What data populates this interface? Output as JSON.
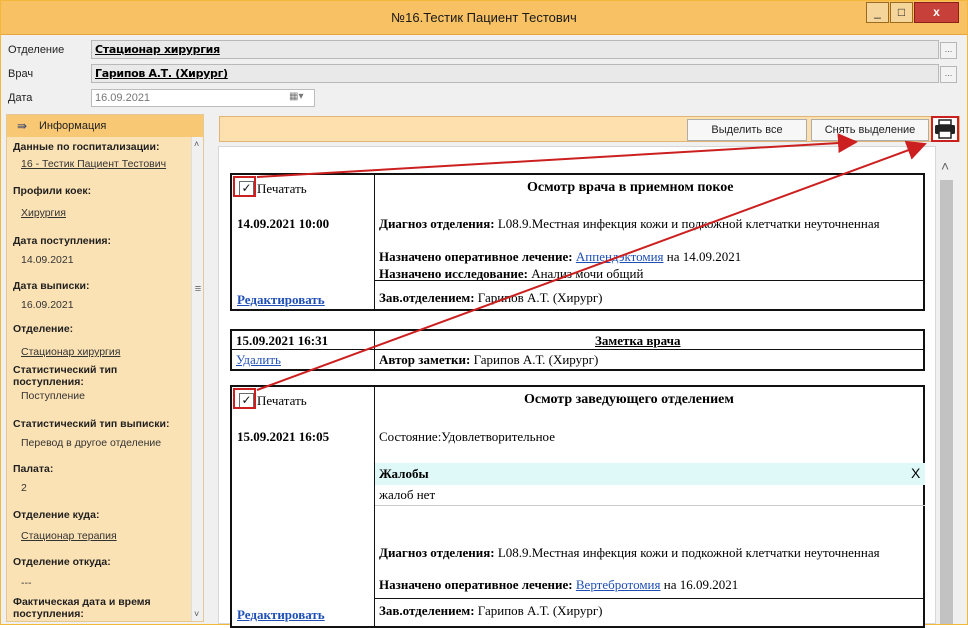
{
  "window": {
    "title": "№16.Тестик Пациент Тестович",
    "controls": {
      "minimize": "_",
      "maximize": "□",
      "close": "x"
    }
  },
  "form": {
    "department_label": "Отделение",
    "department_value": "Стационар хирургия",
    "doctor_label": "Врач",
    "doctor_value": "Гарипов А.Т. (Хирург)",
    "date_label": "Дата",
    "date_value": "16.09.2021",
    "ellipsis": "..."
  },
  "sidebar": {
    "header": "Информация",
    "items": [
      {
        "label": "Данные по госпитализации:",
        "value": "16 - Тестик Пациент Тестович",
        "link": true
      },
      {
        "label": "Профили коек:",
        "value": "Хирургия",
        "link": true
      },
      {
        "label": "Дата поступления:",
        "value": "14.09.2021",
        "link": false
      },
      {
        "label": "Дата выписки:",
        "value": "16.09.2021",
        "link": false
      },
      {
        "label": "Отделение:",
        "value": "Стационар хирургия",
        "link": true
      },
      {
        "label": "Статистический тип поступления:",
        "value": "Поступление",
        "link": false
      },
      {
        "label": "Статистический тип выписки:",
        "value": "Перевод в другое отделение",
        "link": false
      },
      {
        "label": "Палата:",
        "value": "2",
        "link": false
      },
      {
        "label": "Отделение куда:",
        "value": "Стационар терапия",
        "link": true
      },
      {
        "label": "Отделение откуда:",
        "value": "---",
        "link": false
      },
      {
        "label": "Фактическая дата и время поступления:",
        "value": "",
        "link": false
      }
    ]
  },
  "toolbar": {
    "select_all": "Выделить все",
    "deselect": "Снять выделение",
    "print_icon": "printer-icon"
  },
  "records": [
    {
      "print_label": "Печатать",
      "print_checked": true,
      "title": "Осмотр врача в приемном покое",
      "datetime": "14.09.2021 10:00",
      "diag_label": "Диагноз отделения:",
      "diag_value": "L08.9.Местная инфекция кожи и подкожной клетчатки неуточненная",
      "oper_label": "Назначено оперативное лечение:",
      "oper_link": "Аппендэктомия",
      "oper_suffix": "на 14.09.2021",
      "research_label": "Назначено исследование:",
      "research_value": "Анализ мочи общий",
      "edit_link": "Редактировать",
      "head_label": "Зав.отделением:",
      "head_value": "Гарипов А.Т. (Хирург)"
    },
    {
      "datetime": "15.09.2021 16:31",
      "title": "Заметка врача",
      "delete_link": "Удалить",
      "author_label": "Автор заметки:",
      "author_value": "Гарипов А.Т. (Хирург)"
    },
    {
      "print_label": "Печатать",
      "print_checked": true,
      "title": "Осмотр заведующего отделением",
      "datetime": "15.09.2021 16:05",
      "state": "Состояние:Удовлетворительное",
      "complaints_label": "Жалобы",
      "complaints_close": "X",
      "complaints_value": "жалоб нет",
      "diag_label": "Диагноз отделения:",
      "diag_value": "L08.9.Местная инфекция кожи и подкожной клетчатки неуточненная",
      "oper_label": "Назначено оперативное лечение:",
      "oper_link": "Вертебротомия",
      "oper_suffix": "на 16.09.2021",
      "edit_link": "Редактировать",
      "head_label": "Зав.отделением:",
      "head_value": "Гарипов А.Т. (Хирург)"
    }
  ],
  "colors": {
    "titlebar": "#f7c164",
    "sidebar": "#fbe2b5",
    "toolbar": "#fde0ae",
    "annotation": "#cc1f1f",
    "link": "#1f4fb6"
  }
}
